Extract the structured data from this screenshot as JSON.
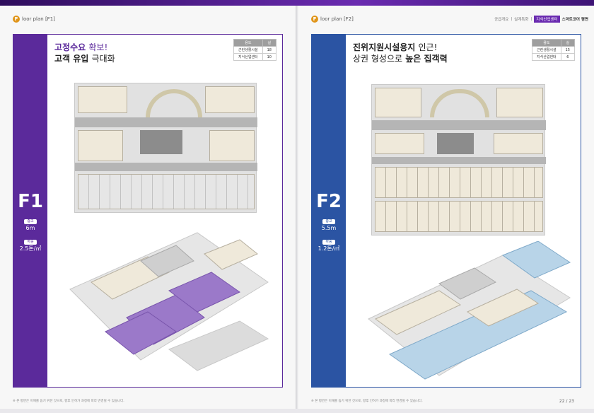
{
  "left": {
    "header_letter": "F",
    "header_text": "loor plan [F1]",
    "headline_line1_bold": "고정수요",
    "headline_line1_thin": "확보!",
    "headline_line2_bold": "고객 유입",
    "headline_line2_thin": "극대화",
    "table": {
      "headers": [
        "용도",
        "실"
      ],
      "rows": [
        [
          "근린생활시설",
          "18"
        ],
        [
          "지식산업센터",
          "10"
        ]
      ]
    },
    "floor": "F1",
    "height_label": "층고",
    "height_value": "6m",
    "load_label": "하중",
    "load_value": "2.5톤/㎡",
    "footnote": "※ 본 평면은 이해를 돕기 위한 것으로, 향후 인허가 과정에 따라 변경될 수 있습니다."
  },
  "right": {
    "header_letter": "F",
    "header_text": "loor plan [F2]",
    "crumbs": [
      "공급개요",
      "설계특화",
      "지식산업센터",
      "스마트코어 평면"
    ],
    "headline_line1_bold": "진위지원시설용지",
    "headline_line1_thin": "인근!",
    "headline_line2_thin": "상권 형성으로",
    "headline_line2_bold": "높은 집객력",
    "table": {
      "headers": [
        "용도",
        "실"
      ],
      "rows": [
        [
          "근린생활시설",
          "15"
        ],
        [
          "지식산업센터",
          "6"
        ]
      ]
    },
    "floor": "F2",
    "height_label": "층고",
    "height_value": "5.5m",
    "load_label": "하중",
    "load_value": "1.2톤/㎡",
    "footnote": "※ 본 평면은 이해를 돕기 위한 것으로, 향후 인허가 과정에 따라 변경될 수 있습니다.",
    "page_numbers": "22 / 23"
  },
  "colors": {
    "purple": "#5b2a9b",
    "blue": "#2b54a3",
    "orange": "#e0951a"
  }
}
